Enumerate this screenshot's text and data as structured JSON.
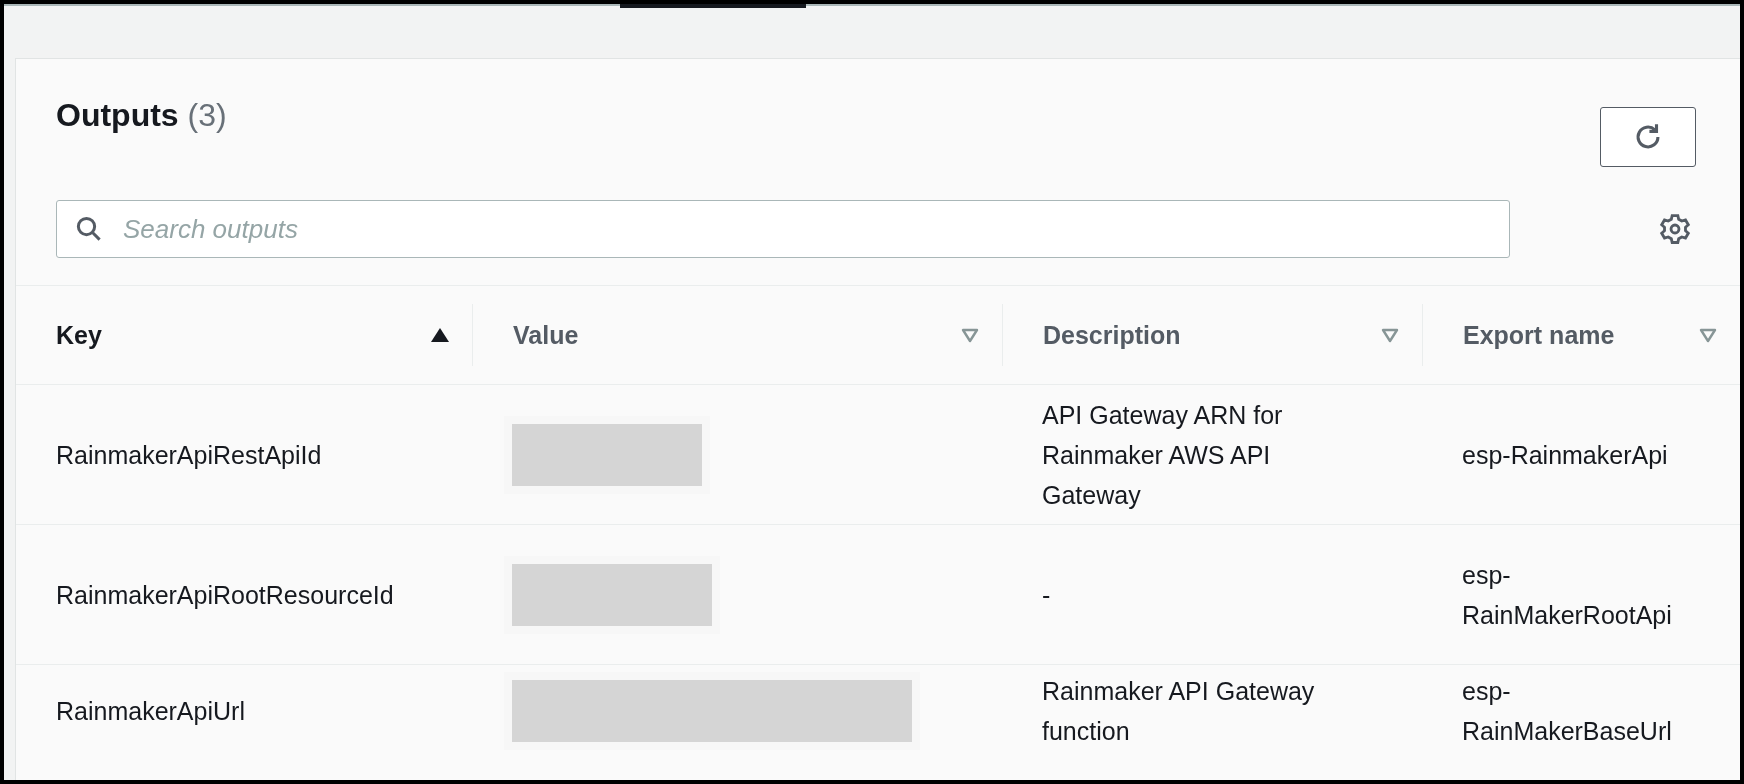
{
  "panel": {
    "title": "Outputs",
    "count": "(3)"
  },
  "search": {
    "placeholder": "Search outputs"
  },
  "table": {
    "columns": [
      {
        "label": "Key",
        "sorted": true
      },
      {
        "label": "Value",
        "sorted": false
      },
      {
        "label": "Description",
        "sorted": false
      },
      {
        "label": "Export name",
        "sorted": false
      }
    ],
    "rows": [
      {
        "key": "RainmakerApiRestApiId",
        "value": {
          "kind": "redacted"
        },
        "description": "API Gateway ARN for Rainmaker AWS API Gateway",
        "export_name": "esp-RainmakerApi"
      },
      {
        "key": "RainmakerApiRootResourceId",
        "value": {
          "kind": "redacted"
        },
        "description": "-",
        "export_name": "esp-RainMakerRootApi"
      },
      {
        "key": "RainmakerApiUrl",
        "value": {
          "kind": "redacted"
        },
        "description": "Rainmaker API Gateway function",
        "export_name": "esp-RainMakerBaseUrl"
      }
    ]
  }
}
